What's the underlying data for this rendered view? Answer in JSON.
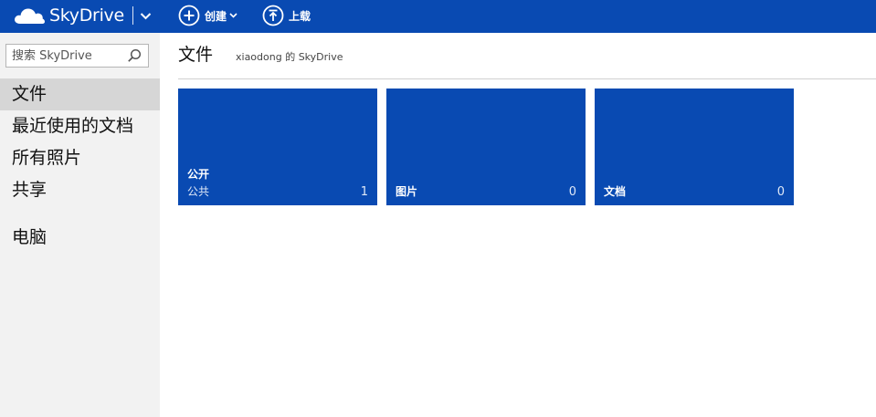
{
  "topbar": {
    "brand_name": "SkyDrive",
    "create_label": "创建",
    "upload_label": "上载",
    "bg_color": "#094ab2"
  },
  "sidebar": {
    "search_placeholder": "搜索 SkyDrive",
    "items": [
      {
        "label": "文件",
        "active": true
      },
      {
        "label": "最近使用的文档",
        "active": false
      },
      {
        "label": "所有照片",
        "active": false
      },
      {
        "label": "共享",
        "active": false
      },
      {
        "label": "电脑",
        "active": false
      }
    ]
  },
  "main": {
    "title": "文件",
    "owner_label": "xiaodong 的 SkyDrive",
    "tiles": [
      {
        "name": "公开",
        "subtitle": "公共",
        "count": "1"
      },
      {
        "name": "图片",
        "count": "0"
      },
      {
        "name": "文档",
        "count": "0"
      }
    ],
    "tile_color": "#094ab2"
  },
  "icons": {
    "brand": "cloud-icon",
    "brand_menu": "chevron-down-icon",
    "create": "plus-circle-icon",
    "create_menu": "chevron-down-icon",
    "upload": "upload-arrow-circle-icon",
    "search": "search-icon"
  }
}
